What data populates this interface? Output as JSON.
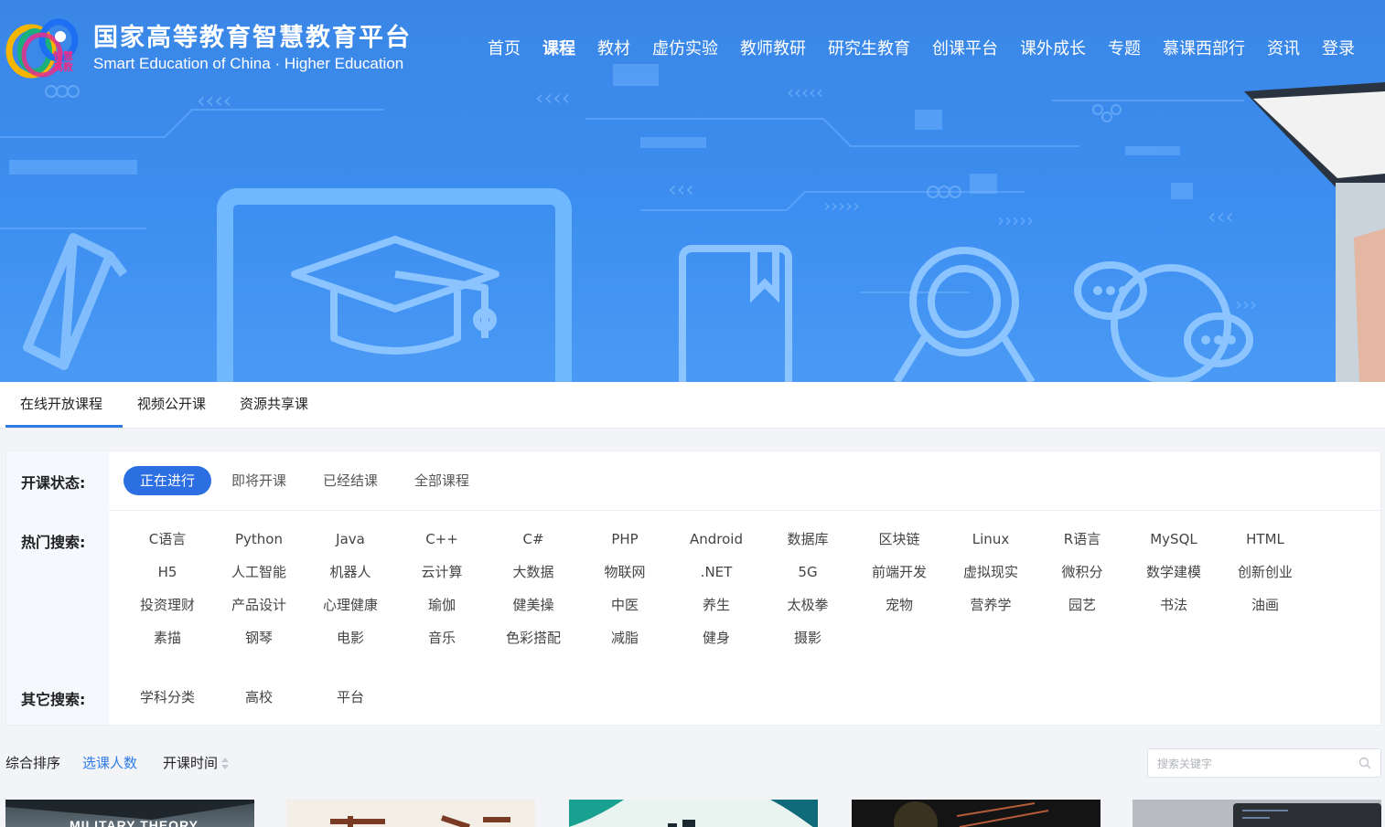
{
  "brand": {
    "name_cn": "国家高等教育智慧教育平台",
    "name_en": "Smart Education of China · Higher Education",
    "badge": "智慧高教"
  },
  "nav": [
    {
      "label": "首页",
      "active": false
    },
    {
      "label": "课程",
      "active": true
    },
    {
      "label": "教材",
      "active": false
    },
    {
      "label": "虚仿实验",
      "active": false
    },
    {
      "label": "教师教研",
      "active": false
    },
    {
      "label": "研究生教育",
      "active": false
    },
    {
      "label": "创课平台",
      "active": false
    },
    {
      "label": "课外成长",
      "active": false
    },
    {
      "label": "专题",
      "active": false
    },
    {
      "label": "慕课西部行",
      "active": false
    },
    {
      "label": "资讯",
      "active": false
    },
    {
      "label": "登录",
      "active": false
    }
  ],
  "tabs": [
    {
      "label": "在线开放课程",
      "active": true
    },
    {
      "label": "视频公开课",
      "active": false
    },
    {
      "label": "资源共享课",
      "active": false
    }
  ],
  "filters": {
    "status_label": "开课状态:",
    "status_options": [
      {
        "label": "正在进行",
        "active": true
      },
      {
        "label": "即将开课",
        "active": false
      },
      {
        "label": "已经结课",
        "active": false
      },
      {
        "label": "全部课程",
        "active": false
      }
    ],
    "hot_label": "热门搜索:",
    "hot_keywords": [
      [
        "C语言",
        "Python",
        "Java",
        "C++",
        "C#",
        "PHP",
        "Android",
        "数据库",
        "区块链",
        "Linux",
        "R语言",
        "MySQL",
        "HTML"
      ],
      [
        "H5",
        "人工智能",
        "机器人",
        "云计算",
        "大数据",
        "物联网",
        ".NET",
        "5G",
        "前端开发",
        "虚拟现实",
        "微积分",
        "数学建模",
        "创新创业"
      ],
      [
        "投资理财",
        "产品设计",
        "心理健康",
        "瑜伽",
        "健美操",
        "中医",
        "养生",
        "太极拳",
        "宠物",
        "营养学",
        "园艺",
        "书法",
        "油画"
      ],
      [
        "素描",
        "钢琴",
        "电影",
        "音乐",
        "色彩搭配",
        "减脂",
        "健身",
        "摄影"
      ]
    ],
    "other_label": "其它搜索:",
    "other_options": [
      "学科分类",
      "高校",
      "平台"
    ]
  },
  "sort": {
    "options": [
      {
        "label": "综合排序",
        "selected": false
      },
      {
        "label": "选课人数",
        "selected": true
      },
      {
        "label": "开课时间",
        "selected": false
      }
    ]
  },
  "search": {
    "placeholder": "搜索关键字",
    "value": ""
  },
  "cards": [
    {
      "caption": "MILITARY THEORY"
    },
    {
      "caption": ""
    },
    {
      "caption": ""
    },
    {
      "caption": ""
    },
    {
      "caption": ""
    }
  ],
  "colors": {
    "accent": "#2c6fe3",
    "hero_bg": "#3c8ef0",
    "selected_text": "#2e7be6"
  }
}
